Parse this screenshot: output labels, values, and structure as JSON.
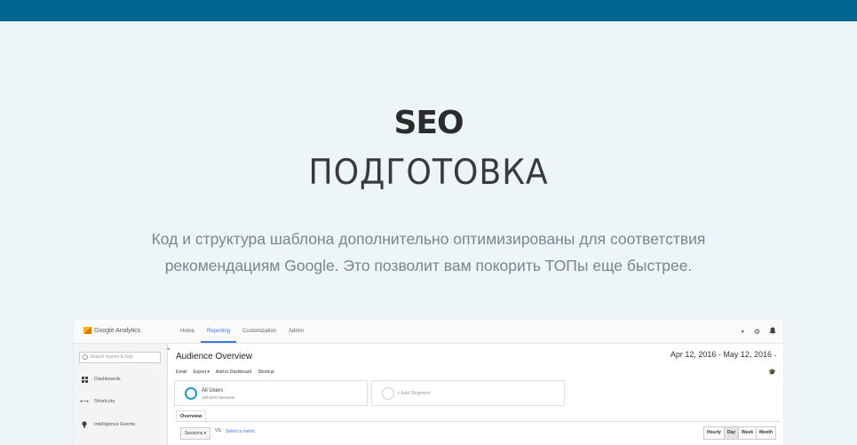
{
  "hero": {
    "title": "SEO",
    "subtitle": "ПОДГОТОВКА",
    "description_line1": "Код и структура шаблона дополнительно оптимизированы для соответствия",
    "description_line2": "рекомендациям Google. Это позволит вам покорить ТОПы еще быстрее."
  },
  "colors": {
    "topbar": "#006593",
    "background": "#eef5f8",
    "accent": "#3b78e7"
  },
  "ga": {
    "logo": "Google Analytics",
    "nav": [
      {
        "label": "Home"
      },
      {
        "label": "Reporting",
        "active": true
      },
      {
        "label": "Customization"
      },
      {
        "label": "Admin"
      }
    ],
    "header_icons": [
      "chevron-down-icon",
      "gear-icon",
      "bell-icon"
    ],
    "sidebar": {
      "search_placeholder": "Search reports & help",
      "items": [
        {
          "label": "Dashboards",
          "icon": "grid-icon"
        },
        {
          "label": "Shortcuts",
          "icon": "arrows-icon"
        },
        {
          "label": "Intelligence Events",
          "icon": "bulb-icon"
        }
      ]
    },
    "page_title": "Audience Overview",
    "date_range": "Apr 12, 2016 - May 12, 2016",
    "actions": [
      "Email",
      "Export ▾",
      "Add to Dashboard",
      "Shortcut"
    ],
    "segments": {
      "all_users": "All Users",
      "all_users_sub": "100.00% Sessions",
      "add_segment": "+ Add Segment"
    },
    "tab": "Overview",
    "metric": "Sessions ▾",
    "vs": "VS.",
    "select_metric": "Select a metric",
    "granularity": [
      {
        "label": "Hourly"
      },
      {
        "label": "Day",
        "active": true
      },
      {
        "label": "Week"
      },
      {
        "label": "Month"
      }
    ]
  }
}
